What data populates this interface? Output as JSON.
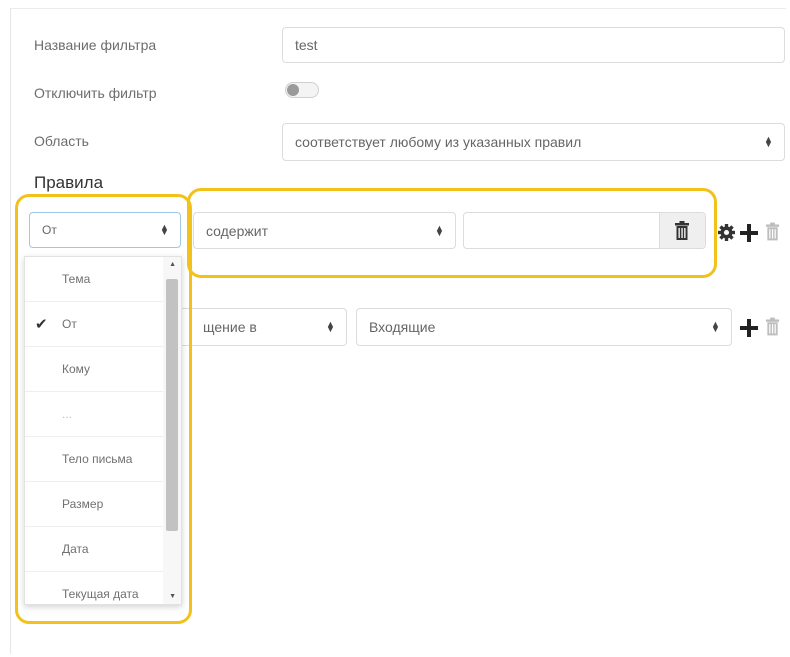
{
  "filter": {
    "name_label": "Название фильтра",
    "name_value": "test",
    "disable_label": "Отключить фильтр",
    "disabled": false,
    "scope_label": "Область",
    "scope_value": "соответствует любому из указанных правил"
  },
  "rules": {
    "heading": "Правила",
    "rule1": {
      "field_value": "От",
      "operator_value": "содержит",
      "text_value": ""
    },
    "rule2": {
      "action_partial": "щение в",
      "folder_value": "Входящие"
    }
  },
  "dropdown": {
    "options": [
      {
        "label": "Тема",
        "checked": false
      },
      {
        "label": "От",
        "checked": true
      },
      {
        "label": "Кому",
        "checked": false
      },
      {
        "label": "...",
        "checked": false
      },
      {
        "label": "Тело письма",
        "checked": false
      },
      {
        "label": "Размер",
        "checked": false
      },
      {
        "label": "Дата",
        "checked": false
      },
      {
        "label": "Текущая дата",
        "checked": false
      }
    ]
  },
  "colors": {
    "highlight": "#f2c21b",
    "border": "#dcdcdc",
    "text": "#666666"
  },
  "icons": [
    "trash-icon",
    "gear-icon",
    "plus-icon",
    "sort-arrows-icon",
    "checkmark-icon"
  ]
}
